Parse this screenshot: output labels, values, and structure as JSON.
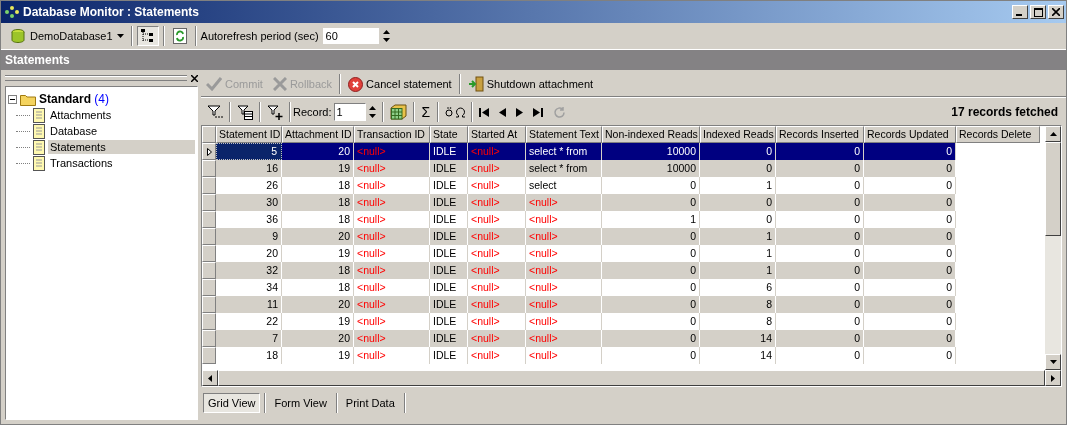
{
  "window": {
    "title": "Database Monitor : Statements"
  },
  "toolbar": {
    "database": "DemoDatabase1",
    "autorefresh_label": "Autorefresh period (sec)",
    "autorefresh_value": "60"
  },
  "section_title": "Statements",
  "tree": {
    "label": "Standard",
    "count": "(4)",
    "expanded": true,
    "children": [
      {
        "label": "Attachments",
        "selected": false
      },
      {
        "label": "Database",
        "selected": false
      },
      {
        "label": "Statements",
        "selected": true
      },
      {
        "label": "Transactions",
        "selected": false
      }
    ]
  },
  "actions": [
    {
      "label": "Commit",
      "kind": "commit",
      "disabled": true
    },
    {
      "label": "Rollback",
      "kind": "rollback",
      "disabled": true
    },
    {
      "label": "Cancel statement",
      "kind": "cancel",
      "disabled": false
    },
    {
      "label": "Shutdown attachment",
      "kind": "shutdown",
      "disabled": false
    }
  ],
  "navigator": {
    "record_label": "Record:",
    "record_value": "1",
    "sum_symbol": "Σ",
    "status": "17 records fetched"
  },
  "table": {
    "columns": [
      {
        "label": "Statement ID",
        "kind": "number"
      },
      {
        "label": "Attachment ID",
        "kind": "number"
      },
      {
        "label": "Transaction ID",
        "kind": "text"
      },
      {
        "label": "State",
        "kind": "text"
      },
      {
        "label": "Started At",
        "kind": "text"
      },
      {
        "label": "Statement Text",
        "kind": "text"
      },
      {
        "label": "Non-indexed Reads",
        "kind": "number"
      },
      {
        "label": "Indexed Reads",
        "kind": "number"
      },
      {
        "label": "Records Inserted",
        "kind": "number"
      },
      {
        "label": "Records Updated",
        "kind": "number"
      },
      {
        "label": "Records Delete"
      }
    ],
    "rows": [
      {
        "selected": true,
        "cells": [
          {
            "text": "5",
            "is_null": false
          },
          {
            "text": "20",
            "is_null": false
          },
          {
            "text": "<null>",
            "is_null": true
          },
          {
            "text": "IDLE",
            "is_null": false
          },
          {
            "text": "<null>",
            "is_null": true
          },
          {
            "text": "select * from",
            "is_null": false
          },
          {
            "text": "10000",
            "is_null": false
          },
          {
            "text": "0",
            "is_null": false
          },
          {
            "text": "0",
            "is_null": false
          },
          {
            "text": "0",
            "is_null": false
          }
        ]
      },
      {
        "selected": false,
        "cells": [
          {
            "text": "16",
            "is_null": false
          },
          {
            "text": "19",
            "is_null": false
          },
          {
            "text": "<null>",
            "is_null": true
          },
          {
            "text": "IDLE",
            "is_null": false
          },
          {
            "text": "<null>",
            "is_null": true
          },
          {
            "text": "select * from",
            "is_null": false
          },
          {
            "text": "10000",
            "is_null": false
          },
          {
            "text": "0",
            "is_null": false
          },
          {
            "text": "0",
            "is_null": false
          },
          {
            "text": "0",
            "is_null": false
          }
        ]
      },
      {
        "selected": false,
        "cells": [
          {
            "text": "26",
            "is_null": false
          },
          {
            "text": "18",
            "is_null": false
          },
          {
            "text": "<null>",
            "is_null": true
          },
          {
            "text": "IDLE",
            "is_null": false
          },
          {
            "text": "<null>",
            "is_null": true
          },
          {
            "text": "select",
            "is_null": false
          },
          {
            "text": "0",
            "is_null": false
          },
          {
            "text": "1",
            "is_null": false
          },
          {
            "text": "0",
            "is_null": false
          },
          {
            "text": "0",
            "is_null": false
          }
        ]
      },
      {
        "selected": false,
        "cells": [
          {
            "text": "30",
            "is_null": false
          },
          {
            "text": "18",
            "is_null": false
          },
          {
            "text": "<null>",
            "is_null": true
          },
          {
            "text": "IDLE",
            "is_null": false
          },
          {
            "text": "<null>",
            "is_null": true
          },
          {
            "text": "<null>",
            "is_null": true
          },
          {
            "text": "0",
            "is_null": false
          },
          {
            "text": "0",
            "is_null": false
          },
          {
            "text": "0",
            "is_null": false
          },
          {
            "text": "0",
            "is_null": false
          }
        ]
      },
      {
        "selected": false,
        "cells": [
          {
            "text": "36",
            "is_null": false
          },
          {
            "text": "18",
            "is_null": false
          },
          {
            "text": "<null>",
            "is_null": true
          },
          {
            "text": "IDLE",
            "is_null": false
          },
          {
            "text": "<null>",
            "is_null": true
          },
          {
            "text": "<null>",
            "is_null": true
          },
          {
            "text": "1",
            "is_null": false
          },
          {
            "text": "0",
            "is_null": false
          },
          {
            "text": "0",
            "is_null": false
          },
          {
            "text": "0",
            "is_null": false
          }
        ]
      },
      {
        "selected": false,
        "cells": [
          {
            "text": "9",
            "is_null": false
          },
          {
            "text": "20",
            "is_null": false
          },
          {
            "text": "<null>",
            "is_null": true
          },
          {
            "text": "IDLE",
            "is_null": false
          },
          {
            "text": "<null>",
            "is_null": true
          },
          {
            "text": "<null>",
            "is_null": true
          },
          {
            "text": "0",
            "is_null": false
          },
          {
            "text": "1",
            "is_null": false
          },
          {
            "text": "0",
            "is_null": false
          },
          {
            "text": "0",
            "is_null": false
          }
        ]
      },
      {
        "selected": false,
        "cells": [
          {
            "text": "20",
            "is_null": false
          },
          {
            "text": "19",
            "is_null": false
          },
          {
            "text": "<null>",
            "is_null": true
          },
          {
            "text": "IDLE",
            "is_null": false
          },
          {
            "text": "<null>",
            "is_null": true
          },
          {
            "text": "<null>",
            "is_null": true
          },
          {
            "text": "0",
            "is_null": false
          },
          {
            "text": "1",
            "is_null": false
          },
          {
            "text": "0",
            "is_null": false
          },
          {
            "text": "0",
            "is_null": false
          }
        ]
      },
      {
        "selected": false,
        "cells": [
          {
            "text": "32",
            "is_null": false
          },
          {
            "text": "18",
            "is_null": false
          },
          {
            "text": "<null>",
            "is_null": true
          },
          {
            "text": "IDLE",
            "is_null": false
          },
          {
            "text": "<null>",
            "is_null": true
          },
          {
            "text": "<null>",
            "is_null": true
          },
          {
            "text": "0",
            "is_null": false
          },
          {
            "text": "1",
            "is_null": false
          },
          {
            "text": "0",
            "is_null": false
          },
          {
            "text": "0",
            "is_null": false
          }
        ]
      },
      {
        "selected": false,
        "cells": [
          {
            "text": "34",
            "is_null": false
          },
          {
            "text": "18",
            "is_null": false
          },
          {
            "text": "<null>",
            "is_null": true
          },
          {
            "text": "IDLE",
            "is_null": false
          },
          {
            "text": "<null>",
            "is_null": true
          },
          {
            "text": "<null>",
            "is_null": true
          },
          {
            "text": "0",
            "is_null": false
          },
          {
            "text": "6",
            "is_null": false
          },
          {
            "text": "0",
            "is_null": false
          },
          {
            "text": "0",
            "is_null": false
          }
        ]
      },
      {
        "selected": false,
        "cells": [
          {
            "text": "11",
            "is_null": false
          },
          {
            "text": "20",
            "is_null": false
          },
          {
            "text": "<null>",
            "is_null": true
          },
          {
            "text": "IDLE",
            "is_null": false
          },
          {
            "text": "<null>",
            "is_null": true
          },
          {
            "text": "<null>",
            "is_null": true
          },
          {
            "text": "0",
            "is_null": false
          },
          {
            "text": "8",
            "is_null": false
          },
          {
            "text": "0",
            "is_null": false
          },
          {
            "text": "0",
            "is_null": false
          }
        ]
      },
      {
        "selected": false,
        "cells": [
          {
            "text": "22",
            "is_null": false
          },
          {
            "text": "19",
            "is_null": false
          },
          {
            "text": "<null>",
            "is_null": true
          },
          {
            "text": "IDLE",
            "is_null": false
          },
          {
            "text": "<null>",
            "is_null": true
          },
          {
            "text": "<null>",
            "is_null": true
          },
          {
            "text": "0",
            "is_null": false
          },
          {
            "text": "8",
            "is_null": false
          },
          {
            "text": "0",
            "is_null": false
          },
          {
            "text": "0",
            "is_null": false
          }
        ]
      },
      {
        "selected": false,
        "cells": [
          {
            "text": "7",
            "is_null": false
          },
          {
            "text": "20",
            "is_null": false
          },
          {
            "text": "<null>",
            "is_null": true
          },
          {
            "text": "IDLE",
            "is_null": false
          },
          {
            "text": "<null>",
            "is_null": true
          },
          {
            "text": "<null>",
            "is_null": true
          },
          {
            "text": "0",
            "is_null": false
          },
          {
            "text": "14",
            "is_null": false
          },
          {
            "text": "0",
            "is_null": false
          },
          {
            "text": "0",
            "is_null": false
          }
        ]
      },
      {
        "selected": false,
        "cells": [
          {
            "text": "18",
            "is_null": false
          },
          {
            "text": "19",
            "is_null": false
          },
          {
            "text": "<null>",
            "is_null": true
          },
          {
            "text": "IDLE",
            "is_null": false
          },
          {
            "text": "<null>",
            "is_null": true
          },
          {
            "text": "<null>",
            "is_null": true
          },
          {
            "text": "0",
            "is_null": false
          },
          {
            "text": "14",
            "is_null": false
          },
          {
            "text": "0",
            "is_null": false
          },
          {
            "text": "0",
            "is_null": false
          }
        ]
      }
    ]
  },
  "view_tabs": [
    {
      "label": "Grid View",
      "selected": true
    },
    {
      "label": "Form View",
      "selected": false
    },
    {
      "label": "Print Data",
      "selected": false
    }
  ]
}
